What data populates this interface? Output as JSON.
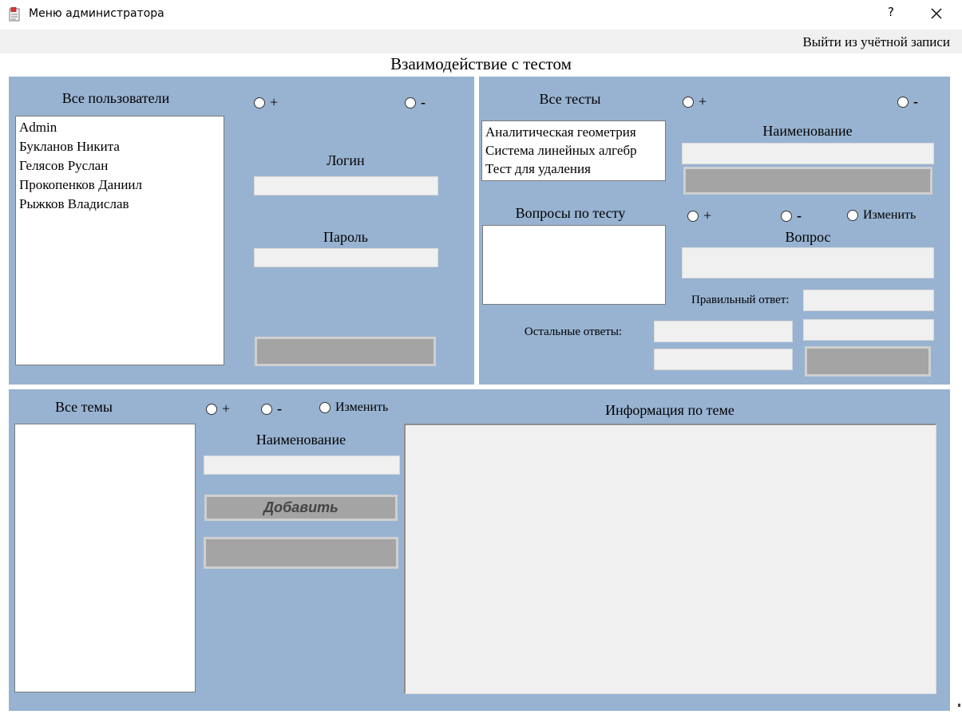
{
  "window": {
    "title": "Меню администратора",
    "help_label": "?",
    "icon": "app-document-icon",
    "close_icon": "close-icon"
  },
  "menubar": {
    "logout_label": "Выйти из учётной записи"
  },
  "main_title": "Взаимодействие с тестом",
  "colors": {
    "panel": "#98b3d1",
    "field": "#f0f0f0",
    "button": "#a4a4a4"
  },
  "users_panel": {
    "list_label": "Все пользователи",
    "radio_add": "+",
    "radio_remove": "-",
    "users": [
      "Admin",
      "Букланов Никита",
      "Гелясов Руслан",
      "Прокопенков Даниил",
      "Рыжков Владислав"
    ],
    "login_label": "Логин",
    "login_value": "",
    "password_label": "Пароль",
    "password_value": ""
  },
  "tests_panel": {
    "list_label": "Все тесты",
    "radio_add": "+",
    "radio_remove": "-",
    "tests": [
      "Аналитическая геометрия",
      "Система линейных алгебр",
      "Тест для удаления"
    ],
    "name_label": "Наименование",
    "name_value": "",
    "questions_label": "Вопросы по тесту",
    "q_radio_add": "+",
    "q_radio_remove": "-",
    "q_radio_edit": "Изменить",
    "question_label": "Вопрос",
    "correct_answer_label": "Правильный ответ:",
    "other_answers_label": "Остальные ответы:"
  },
  "topics_panel": {
    "list_label": "Все темы",
    "radio_add": "+",
    "radio_remove": "-",
    "radio_edit": "Изменить",
    "name_label": "Наименование",
    "name_value": "",
    "add_button_label": "Добавить",
    "info_label": "Информация по теме"
  }
}
